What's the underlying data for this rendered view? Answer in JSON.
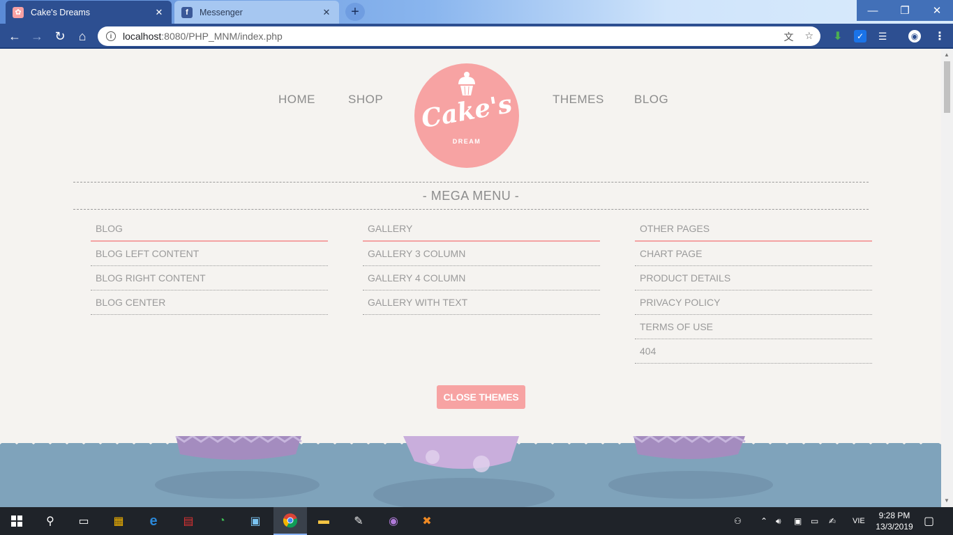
{
  "browser": {
    "tabs": [
      {
        "title": "Cake's Dreams",
        "active": true
      },
      {
        "title": "Messenger",
        "active": false
      }
    ],
    "new_tab": "+",
    "window_controls": {
      "minimize": "—",
      "restore": "❐",
      "close": "✕"
    },
    "address": {
      "host": "localhost",
      "path": ":8080/PHP_MNM/index.php"
    },
    "nav": {
      "back": "←",
      "forward": "→",
      "reload": "↻",
      "home": "⌂"
    },
    "omnibox_icons": {
      "translate": "文",
      "bookmark": "☆"
    }
  },
  "site": {
    "nav_left": [
      "HOME",
      "SHOP"
    ],
    "nav_right": [
      "THEMES",
      "BLOG"
    ],
    "logo": {
      "script": "Cake's",
      "sub": "DREAM"
    },
    "mega_menu_title": "- MEGA MENU -",
    "columns": [
      {
        "heading": "BLOG",
        "items": [
          "BLOG LEFT CONTENT",
          "BLOG RIGHT CONTENT",
          "BLOG CENTER"
        ]
      },
      {
        "heading": "GALLERY",
        "items": [
          "GALLERY 3 COLUMN",
          "GALLERY 4 COLUMN",
          "GALLERY WITH TEXT"
        ]
      },
      {
        "heading": "OTHER PAGES",
        "items": [
          "CHART PAGE",
          "PRODUCT DETAILS",
          "PRIVACY POLICY",
          "TERMS OF USE",
          "404"
        ]
      }
    ],
    "close_button": "CLOSE THEMES",
    "accent": "#f7a3a3",
    "water_color": "#7fa3bb"
  },
  "taskbar": {
    "clock_time": "9:28 PM",
    "clock_date": "13/3/2019",
    "language": "VIE"
  }
}
